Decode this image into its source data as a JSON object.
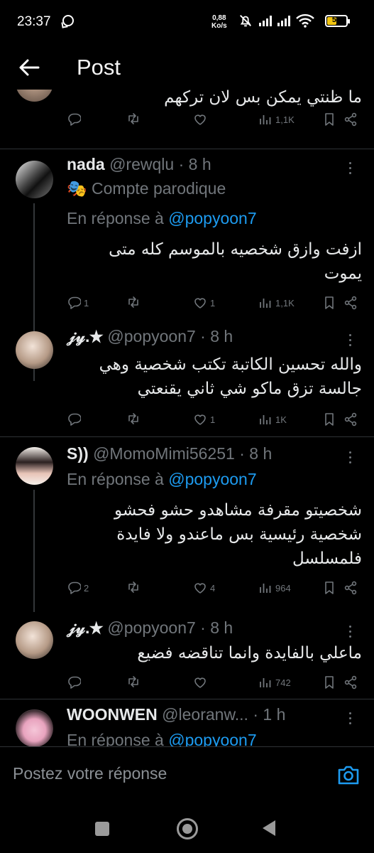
{
  "status_bar": {
    "time": "23:37",
    "net_speed_value": "0,88",
    "net_speed_unit": "Ko/s",
    "battery": "51",
    "battery_level": 0.51,
    "accent_color": "#f1c40f"
  },
  "header": {
    "title": "Post"
  },
  "posts": [
    {
      "text": "ما ظنتي يمكن بس لان تركهم",
      "reply_count": "",
      "retweet_count": "",
      "like_count": "",
      "views": "1,1K"
    },
    {
      "name": "nada",
      "handle": "@rewqlu",
      "time": "8 h",
      "parody_label": "Compte parodique",
      "reply_prefix": "En réponse à",
      "reply_to": "@popyoon7",
      "text": "ازفت وازق شخصيه بالموسم كله متى يموت",
      "reply_count": "1",
      "retweet_count": "",
      "like_count": "1",
      "views": "1,1K"
    },
    {
      "name": "𝒿𝓎.★",
      "handle": "@popyoon7",
      "time": "8 h",
      "text": "والله تحسين الكاتبة تكتب شخصية وهي جالسة تزق ماكو شي ثاني يقنعتي",
      "reply_count": "",
      "retweet_count": "",
      "like_count": "1",
      "views": "1K"
    },
    {
      "name": "S))",
      "handle": "@MomoMimi56251",
      "time": "8 h",
      "reply_prefix": "En réponse à",
      "reply_to": "@popyoon7",
      "text": "شخصيتو مقرفة مشاهدو حشو فحشو شخصية رئيسية بس ماعندو ولا فايدة فلمسلسل",
      "reply_count": "2",
      "retweet_count": "",
      "like_count": "4",
      "views": "964"
    },
    {
      "name": "𝒿𝓎.★",
      "handle": "@popyoon7",
      "time": "8 h",
      "text": "ماعلي بالفايدة وانما تناقضه فضيع",
      "reply_count": "",
      "retweet_count": "",
      "like_count": "",
      "views": "742"
    },
    {
      "name": "WOONWEN",
      "handle": "@leoranw...",
      "time": "1 h",
      "reply_prefix": "En réponse à",
      "reply_to": "@popyoon7"
    }
  ],
  "separator": "·",
  "composer": {
    "placeholder": "Postez votre réponse"
  },
  "icons": {
    "back": "arrow-left-icon",
    "reply": "reply-icon",
    "retweet": "retweet-icon",
    "like": "heart-icon",
    "views": "views-icon",
    "bookmark": "bookmark-icon",
    "share": "share-icon",
    "camera": "camera-icon",
    "parody": "mask-icon"
  },
  "colors": {
    "link": "#1d9bf0",
    "muted": "#71767b",
    "background": "#000000"
  }
}
